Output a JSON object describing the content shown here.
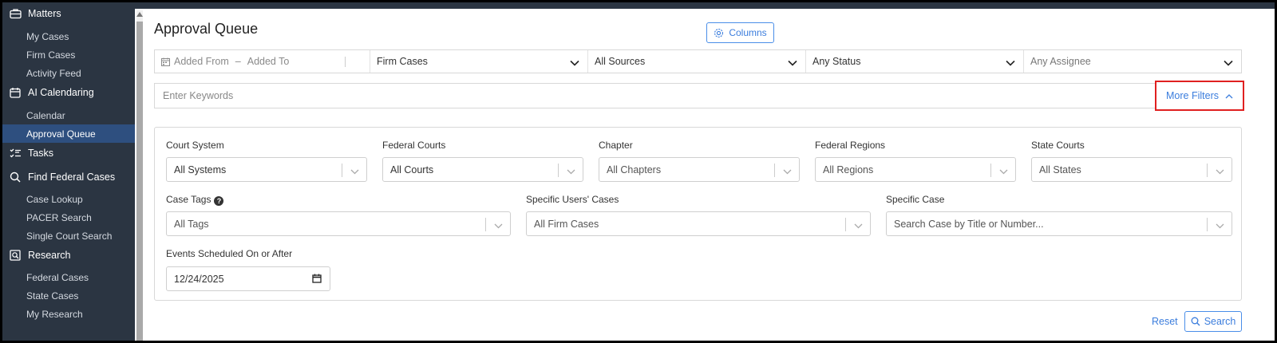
{
  "sidebar": {
    "matters": {
      "label": "Matters",
      "icon": "briefcase-icon"
    },
    "matters_items": [
      "My Cases",
      "Firm Cases",
      "Activity Feed"
    ],
    "ai_calendaring": {
      "label": "AI Calendaring",
      "icon": "calendar-icon"
    },
    "ai_calendaring_items": [
      "Calendar",
      "Approval Queue"
    ],
    "tasks": {
      "label": "Tasks",
      "icon": "checklist-icon"
    },
    "find_federal": {
      "label": "Find Federal Cases",
      "icon": "search-icon"
    },
    "find_federal_items": [
      "Case Lookup",
      "PACER Search",
      "Single Court Search"
    ],
    "research": {
      "label": "Research",
      "icon": "research-icon"
    },
    "research_items": [
      "Federal Cases",
      "State Cases",
      "My Research"
    ],
    "active_item": "Approval Queue"
  },
  "page": {
    "title": "Approval Queue",
    "columns_button": "Columns"
  },
  "filterbar": {
    "added_from": "Added From",
    "dash": "–",
    "added_to": "Added To",
    "case_scope": "Firm Cases",
    "sources": "All Sources",
    "status": "Any Status",
    "assignee": "Any Assignee"
  },
  "keywords": {
    "placeholder": "Enter Keywords",
    "more_filters": "More Filters"
  },
  "filters": {
    "court_system": {
      "label": "Court System",
      "value": "All Systems"
    },
    "federal_courts": {
      "label": "Federal Courts",
      "value": "All Courts"
    },
    "chapter": {
      "label": "Chapter",
      "value": "All Chapters"
    },
    "federal_regions": {
      "label": "Federal Regions",
      "value": "All Regions"
    },
    "state_courts": {
      "label": "State Courts",
      "value": "All States"
    },
    "case_tags": {
      "label": "Case Tags",
      "value": "All Tags"
    },
    "specific_users": {
      "label": "Specific Users' Cases",
      "value": "All Firm Cases"
    },
    "specific_case": {
      "label": "Specific Case",
      "value": "Search Case by Title or Number..."
    },
    "events_scheduled": {
      "label": "Events Scheduled On or After",
      "value": "12/24/2025"
    }
  },
  "actions": {
    "reset": "Reset",
    "search": "Search"
  },
  "colors": {
    "sidebar_bg": "#2b3542",
    "active_bg": "#2e4f7f",
    "accent": "#3b7ddd",
    "highlight_border": "#e02020"
  }
}
